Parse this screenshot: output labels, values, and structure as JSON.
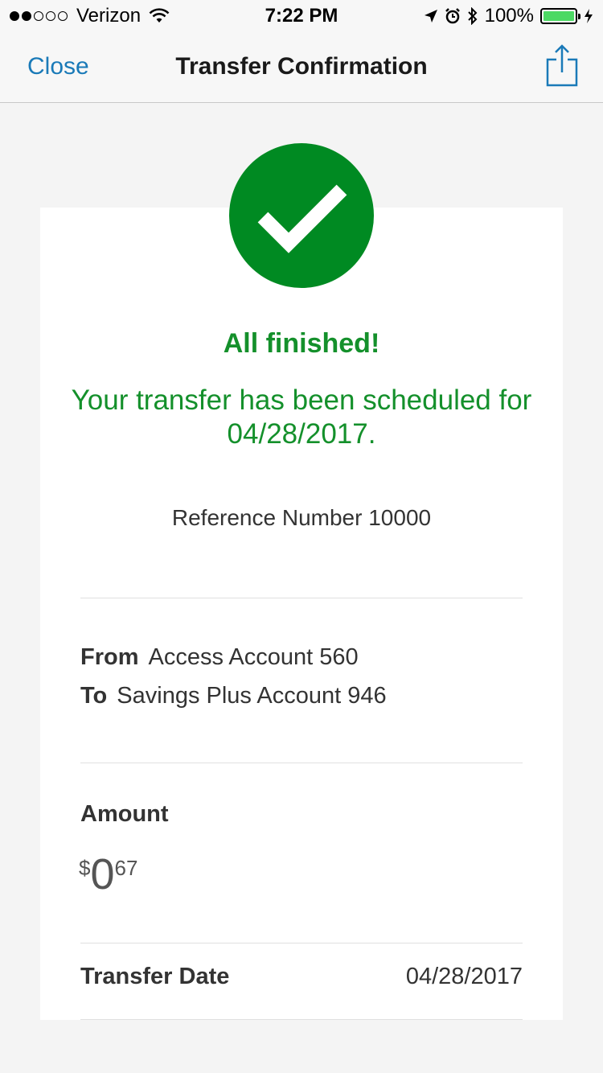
{
  "status_bar": {
    "carrier": "Verizon",
    "time": "7:22 PM",
    "battery": "100%"
  },
  "nav": {
    "close_label": "Close",
    "title": "Transfer Confirmation"
  },
  "confirmation": {
    "headline": "All finished!",
    "message": "Your transfer has been scheduled for 04/28/2017.",
    "reference": "Reference Number 10000"
  },
  "accounts": {
    "from_label": "From",
    "from_value": "Access Account 560",
    "to_label": "To",
    "to_value": "Savings Plus Account 946"
  },
  "amount": {
    "label": "Amount",
    "currency": "$",
    "whole": "0",
    "cents": "67"
  },
  "transfer_date": {
    "label": "Transfer Date",
    "value": "04/28/2017"
  },
  "colors": {
    "accent": "#1a7ab8",
    "success": "#008a22"
  }
}
